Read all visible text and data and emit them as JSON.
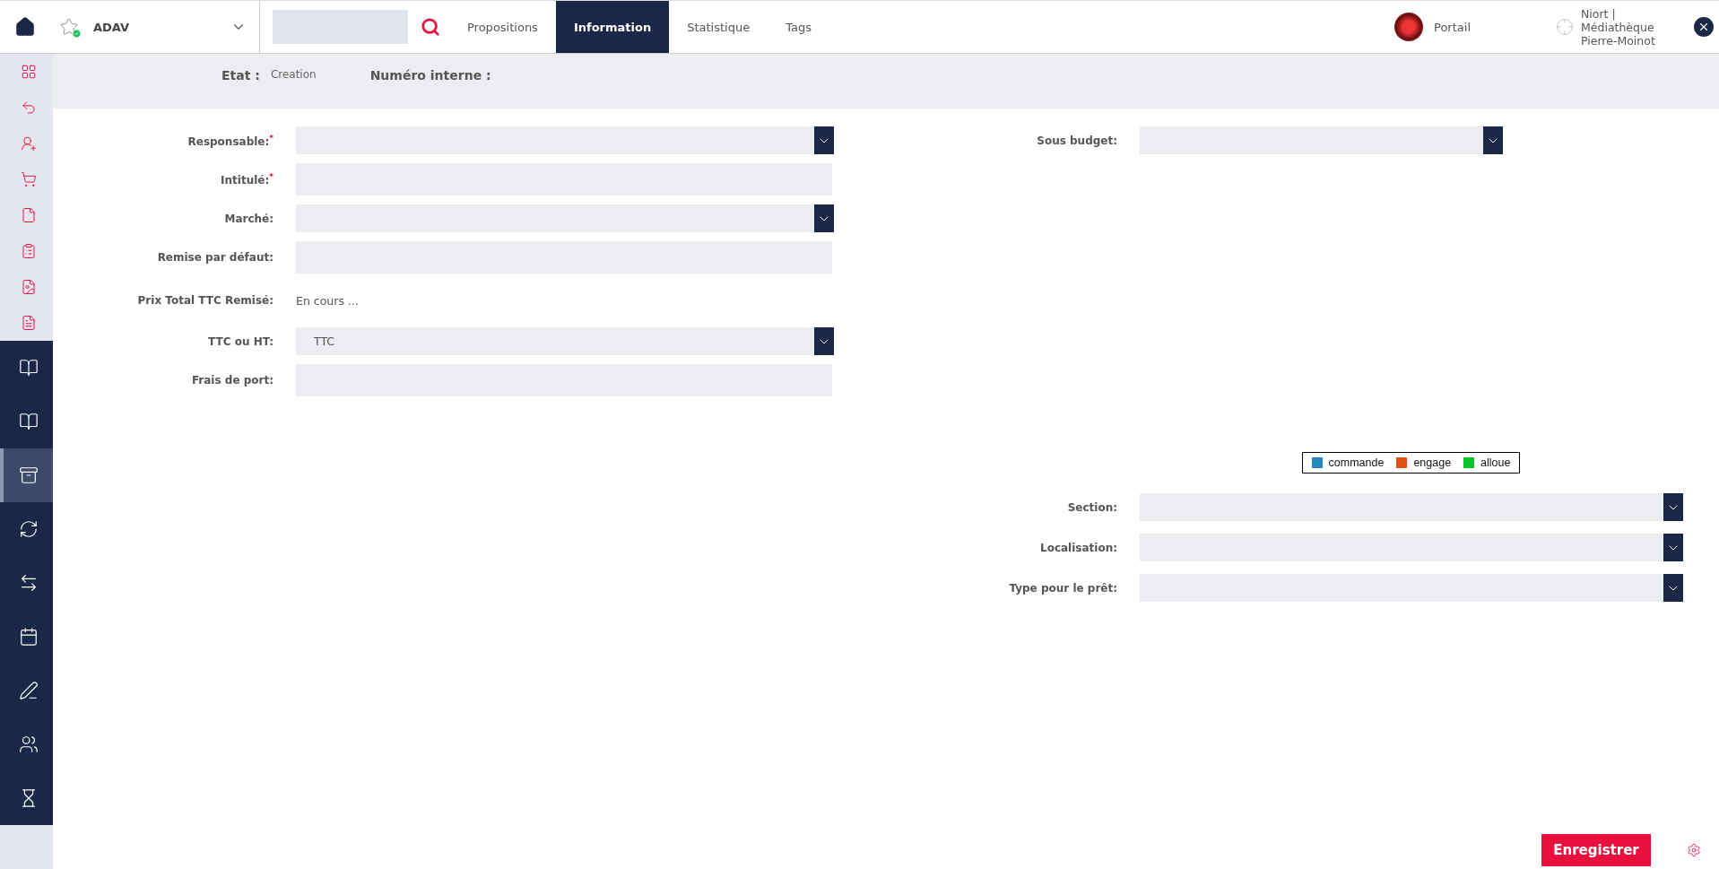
{
  "topbar": {
    "account": {
      "name": "ADAV",
      "verified": true
    },
    "search": {
      "kind": "box"
    },
    "tabs": [
      {
        "label": "Propositions",
        "selected": false
      },
      {
        "label": "Information",
        "selected": true
      },
      {
        "label": "Statistique",
        "selected": false
      },
      {
        "label": "Tags",
        "selected": false
      }
    ],
    "portal": {
      "label": "Portail"
    },
    "library": {
      "label": "Niort | Médiathèque Pierre-Moinot"
    }
  },
  "sidebar": {
    "items": [
      {
        "kind": "light",
        "selected": false
      },
      {
        "kind": "light",
        "selected": false
      },
      {
        "kind": "light",
        "selected": false
      },
      {
        "kind": "light",
        "selected": false
      },
      {
        "kind": "light",
        "selected": false
      },
      {
        "kind": "light",
        "selected": false
      },
      {
        "kind": "light",
        "selected": false
      },
      {
        "kind": "light",
        "selected": false
      },
      {
        "kind": "dark",
        "selected": false
      },
      {
        "kind": "dark",
        "selected": false
      },
      {
        "kind": "dark",
        "selected": true
      },
      {
        "kind": "dark",
        "selected": false
      },
      {
        "kind": "dark",
        "selected": false
      },
      {
        "kind": "dark",
        "selected": false
      },
      {
        "kind": "dark",
        "selected": false
      },
      {
        "kind": "dark",
        "selected": false
      },
      {
        "kind": "dark",
        "selected": false
      }
    ]
  },
  "header": {
    "state_label": "Etat :",
    "state_value": "Creation",
    "number_label": "Numéro interne :"
  },
  "form_left": [
    {
      "label": "Responsable:$^{*}$",
      "kind": "select"
    },
    {
      "label": "Intitulé:$^{*}$",
      "kind": "text"
    },
    {
      "label": "Marché:",
      "kind": "select"
    },
    {
      "label": "Remise par défaut:",
      "kind": "text"
    },
    {
      "label": "Prix Total TTC Remisé:",
      "kind": "static",
      "value": "En cours ..."
    },
    {
      "label": "TTC ou HT:",
      "kind": "select",
      "value": "TTC"
    },
    {
      "label": "Frais de port:",
      "kind": "text"
    }
  ],
  "budget": {
    "label": "Sous budget:",
    "kind": "select"
  },
  "legend": [
    {
      "label": "commande",
      "color": "#2189c0"
    },
    {
      "label": "engage",
      "color": "#e0500e"
    },
    {
      "label": "alloue",
      "color": "#0cc22a"
    }
  ],
  "form_right": [
    {
      "label": "Section:",
      "kind": "select"
    },
    {
      "label": "Localisation:",
      "kind": "select"
    },
    {
      "label": "Type pour le prêt:",
      "kind": "select"
    }
  ],
  "footer": {
    "save": "Enregistrer"
  }
}
